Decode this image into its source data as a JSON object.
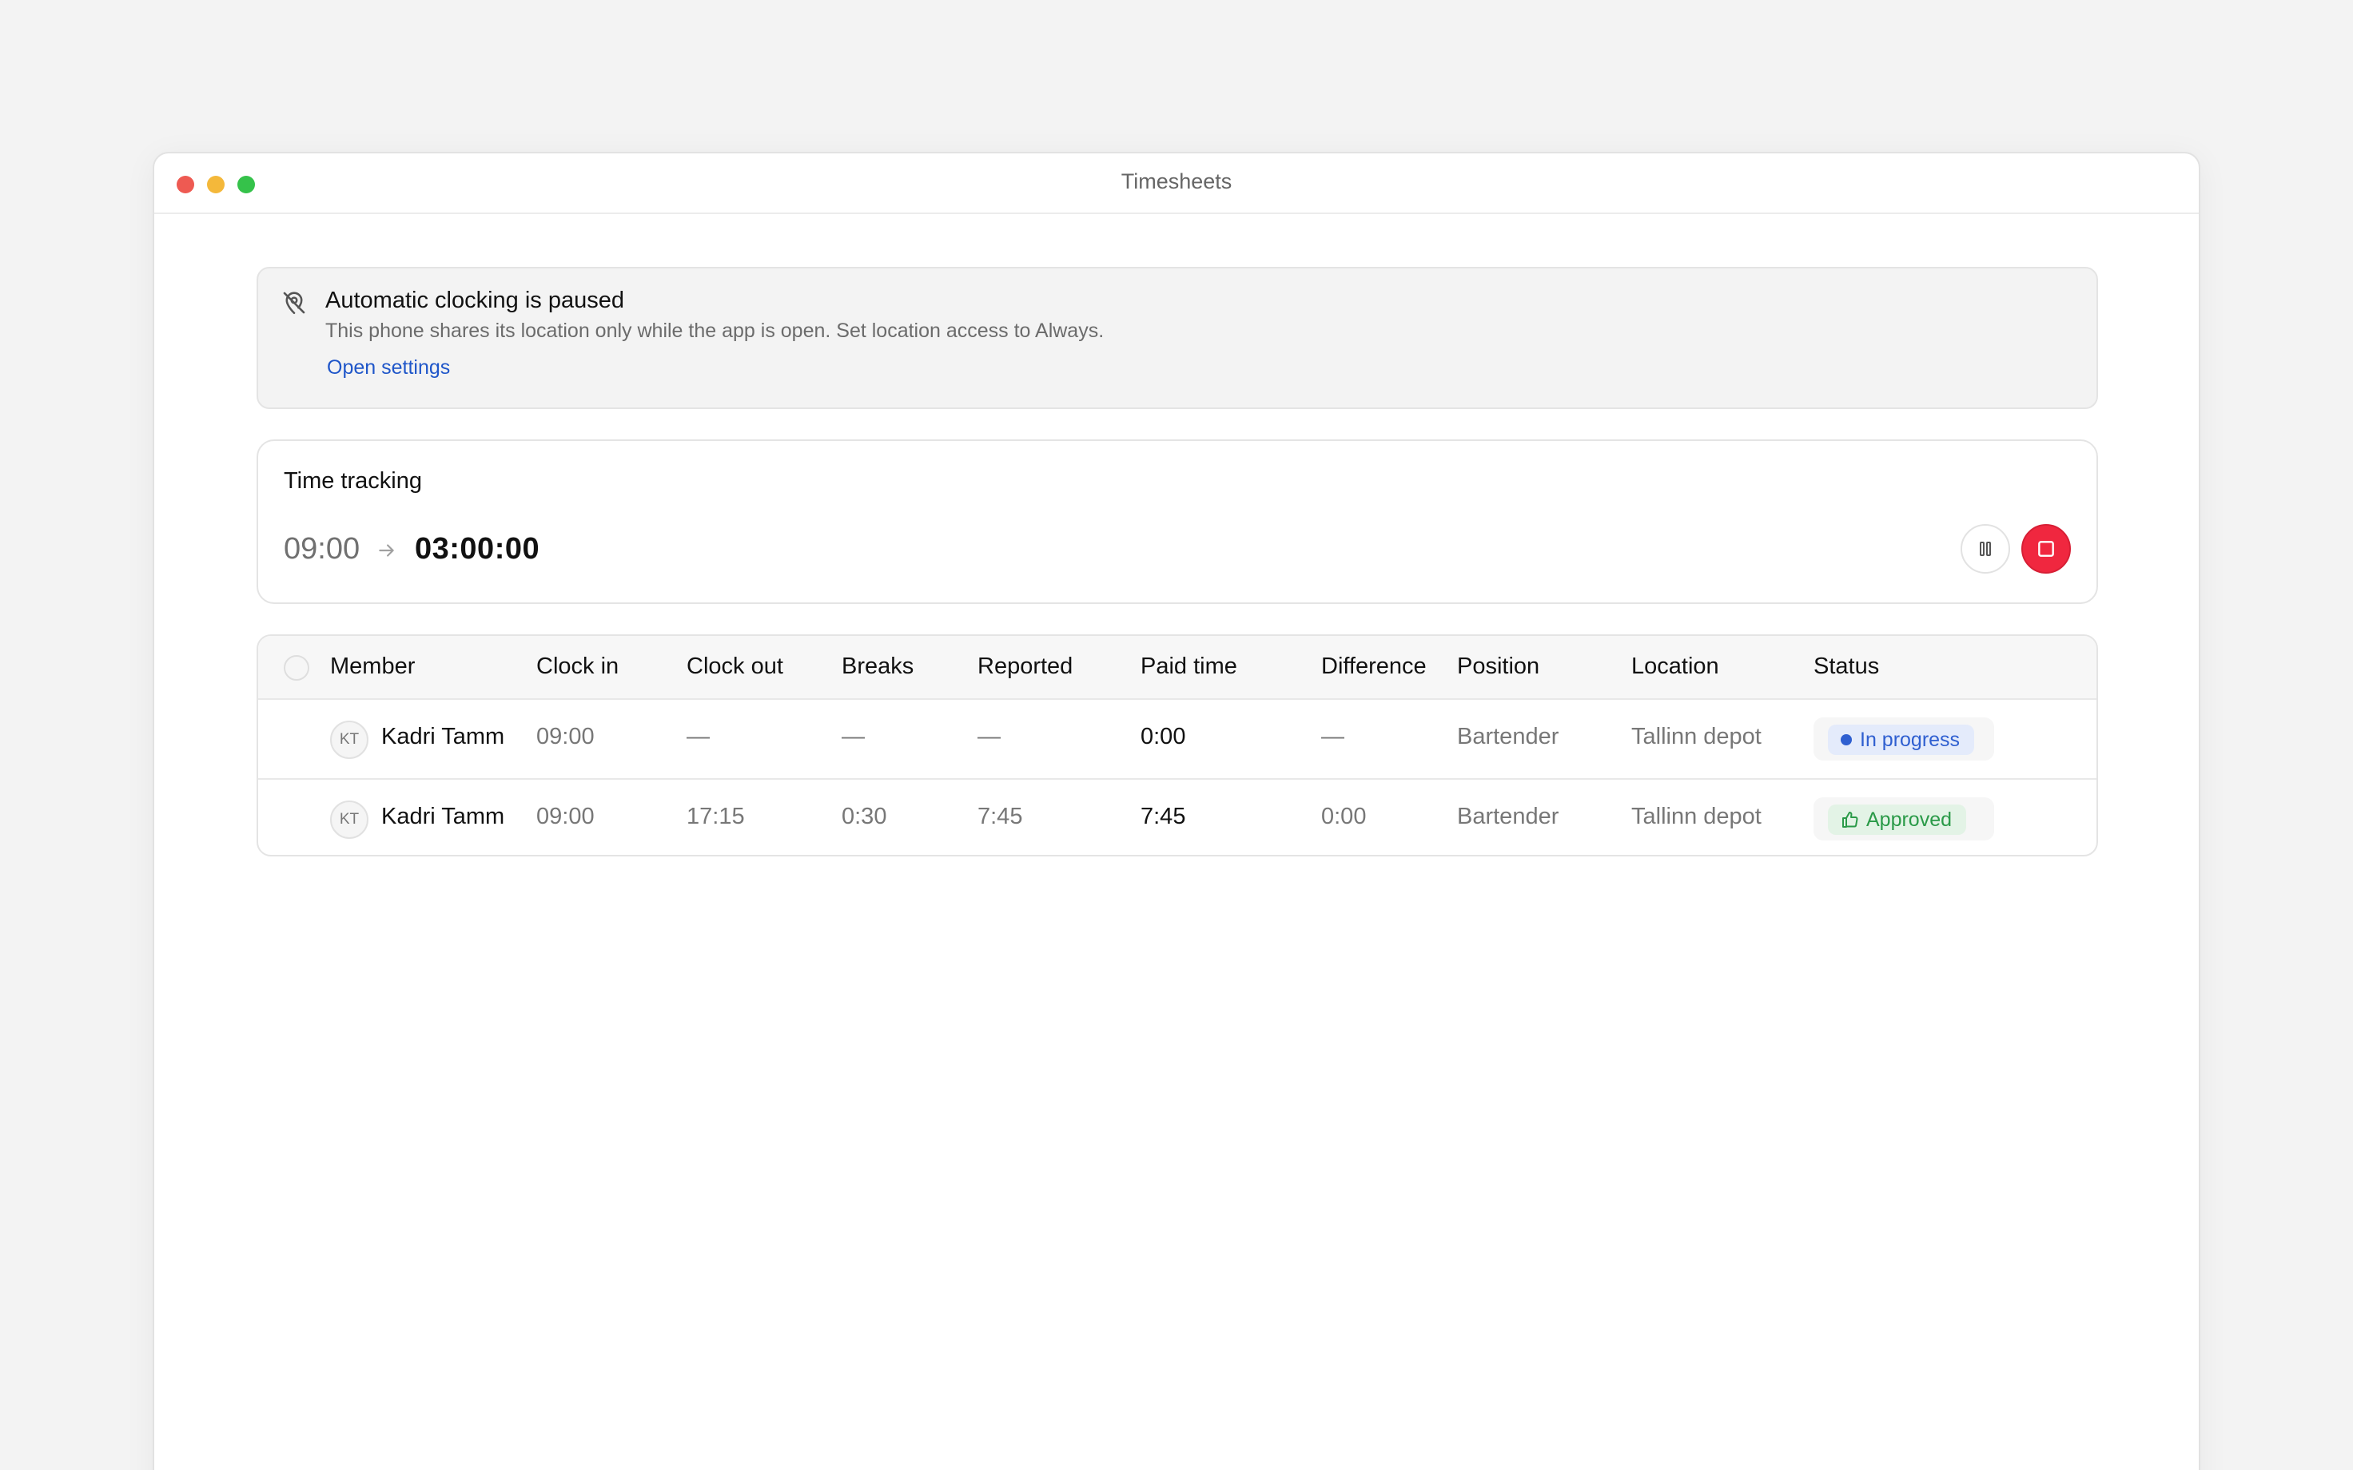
{
  "window": {
    "title": "Timesheets"
  },
  "alert": {
    "icon": "location-off-icon",
    "title": "Automatic clocking is paused",
    "description": "This phone shares its location only while the app is open. Set location access to Always.",
    "link": "Open settings"
  },
  "tracking": {
    "title": "Time tracking",
    "start": "09:00",
    "elapsed": "03:00:00",
    "buttons": {
      "pause": "pause-icon",
      "stop": "stop-icon"
    },
    "colors": {
      "stop": "#f0273f"
    }
  },
  "table": {
    "headers": [
      "Member",
      "Clock in",
      "Clock out",
      "Breaks",
      "Reported",
      "Paid time",
      "Difference",
      "Position",
      "Location",
      "Status"
    ],
    "rows": [
      {
        "initials": "KT",
        "member": "Kadri Tamm",
        "clock_in": "09:00",
        "clock_out": "—",
        "breaks": "—",
        "reported": "—",
        "paid_time": "0:00",
        "difference": "—",
        "position": "Bartender",
        "location": "Tallinn depot",
        "status": "In progress"
      },
      {
        "initials": "KT",
        "member": "Kadri Tamm",
        "clock_in": "09:00",
        "clock_out": "17:15",
        "breaks": "0:30",
        "reported": "7:45",
        "paid_time": "7:45",
        "difference": "0:00",
        "position": "Bartender",
        "location": "Tallinn depot",
        "status": "Approved"
      }
    ],
    "status_colors": {
      "in_progress": "#2f5fd0",
      "approved": "#2a9a48"
    }
  }
}
